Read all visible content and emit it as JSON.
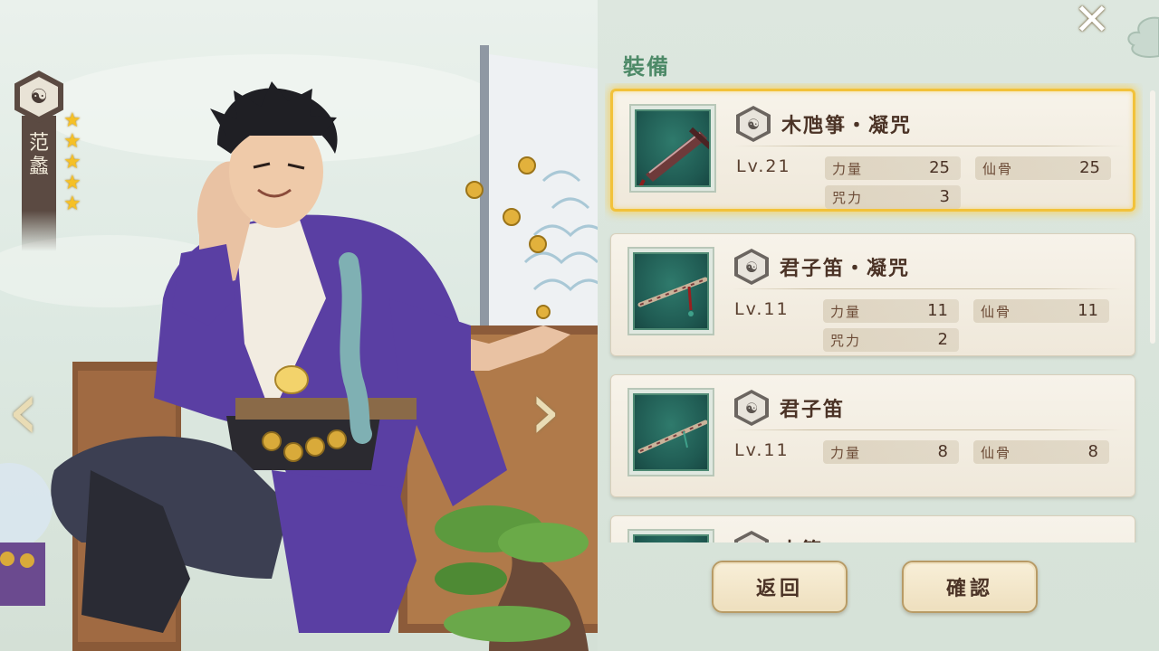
{
  "panel": {
    "title": "裝備",
    "close_icon": "close-x-icon"
  },
  "character": {
    "name_chars": [
      "范",
      "蠡"
    ],
    "emblem_icon": "taiji-icon",
    "stars": 5,
    "star_icon": "star-icon"
  },
  "navigation": {
    "prev_icon": "chevron-left-icon",
    "next_icon": "chevron-right-icon"
  },
  "items": [
    {
      "name": "木虺箏・凝咒",
      "level": "Lv.21",
      "selected": true,
      "stats": [
        {
          "name": "力量",
          "value": "25"
        },
        {
          "name": "仙骨",
          "value": "25"
        },
        {
          "name": "咒力",
          "value": "3"
        }
      ],
      "icon": "zither-weapon-icon"
    },
    {
      "name": "君子笛・凝咒",
      "level": "Lv.11",
      "selected": false,
      "stats": [
        {
          "name": "力量",
          "value": "11"
        },
        {
          "name": "仙骨",
          "value": "11"
        },
        {
          "name": "咒力",
          "value": "2"
        }
      ],
      "icon": "flute-weapon-icon"
    },
    {
      "name": "君子笛",
      "level": "Lv.11",
      "selected": false,
      "stats": [
        {
          "name": "力量",
          "value": "8"
        },
        {
          "name": "仙骨",
          "value": "8"
        }
      ],
      "icon": "flute-weapon-icon"
    },
    {
      "name": "木箏",
      "level": "",
      "selected": false,
      "stats": [],
      "icon": "weapon-icon"
    }
  ],
  "buttons": {
    "back": "返回",
    "confirm": "確認"
  },
  "colors": {
    "title_green": "#4e8a68",
    "selected_gold": "#f2c23a",
    "card_bg": "#f4efe3",
    "icon_teal": "#1f5a52",
    "star_gold": "#f5c026"
  }
}
